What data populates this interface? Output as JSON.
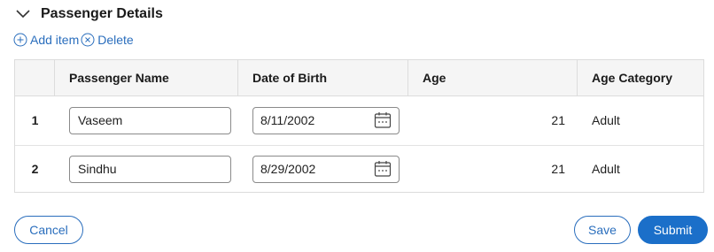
{
  "section": {
    "title": "Passenger Details"
  },
  "actions": {
    "add_label": "Add item",
    "delete_label": "Delete"
  },
  "table": {
    "columns": [
      "",
      "Passenger Name",
      "Date of Birth",
      "Age",
      "Age Category"
    ],
    "rows": [
      {
        "index": "1",
        "name": "Vaseem",
        "dob": "8/11/2002",
        "age": "21",
        "category": "Adult"
      },
      {
        "index": "2",
        "name": "Sindhu",
        "dob": "8/29/2002",
        "age": "21",
        "category": "Adult"
      }
    ]
  },
  "footer": {
    "cancel_label": "Cancel",
    "save_label": "Save",
    "submit_label": "Submit"
  },
  "colors": {
    "accent": "#1b6fc9",
    "link": "#2a6ebd",
    "header_bg": "#f5f5f5",
    "border": "#dcdcdc"
  }
}
